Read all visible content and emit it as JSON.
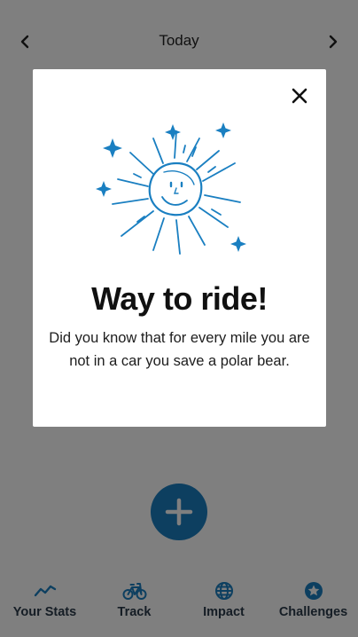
{
  "header": {
    "title": "Today",
    "prev_icon": "chevron-left-icon",
    "next_icon": "chevron-right-icon"
  },
  "fab": {
    "icon": "plus-icon"
  },
  "tabs": [
    {
      "label": "Your Stats",
      "icon": "trend-line-icon"
    },
    {
      "label": "Track",
      "icon": "bicycle-icon"
    },
    {
      "label": "Impact",
      "icon": "globe-icon"
    },
    {
      "label": "Challenges",
      "icon": "star-badge-icon"
    }
  ],
  "modal": {
    "title": "Way to ride!",
    "message": "Did you know that for every mile you are not in a car you save a polar bear.",
    "close_icon": "close-icon",
    "illustration": "sun-sparkle-illustration"
  },
  "colors": {
    "accent": "#1a7fc1",
    "tab_icon": "#1a7fc1",
    "tab_label": "#2b3a4a",
    "overlay": "rgba(0,0,0,0.5)"
  }
}
